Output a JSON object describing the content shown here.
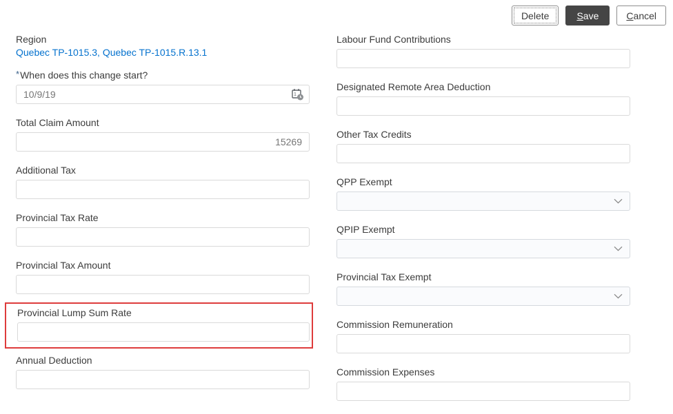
{
  "toolbar": {
    "delete_label": "Delete",
    "save_key": "S",
    "save_rest": "ave",
    "cancel_key": "C",
    "cancel_rest": "ancel"
  },
  "colors": {
    "link_blue": "#0572ce",
    "highlight_red": "#de3b3b",
    "save_button_bg": "#454545",
    "muted_value_gray": "#767676"
  },
  "region": {
    "label": "Region",
    "value": "Quebec TP-1015.3, Quebec TP-1015.R.13.1"
  },
  "left": {
    "start_date": {
      "required_marker": "*",
      "label": "When does this change start?",
      "value": "10/9/19",
      "icon": "calendar-clock-icon"
    },
    "total_claim": {
      "label": "Total Claim Amount",
      "value": "15269"
    },
    "additional_tax": {
      "label": "Additional Tax",
      "value": ""
    },
    "prov_tax_rate": {
      "label": "Provincial Tax Rate",
      "value": ""
    },
    "prov_tax_amount": {
      "label": "Provincial Tax Amount",
      "value": ""
    },
    "prov_lump_sum_rate": {
      "label": "Provincial Lump Sum Rate",
      "value": "",
      "highlighted": true
    },
    "annual_deduction": {
      "label": "Annual Deduction",
      "value": ""
    }
  },
  "right": {
    "labour_fund": {
      "label": "Labour Fund Contributions",
      "value": ""
    },
    "remote_area": {
      "label": "Designated Remote Area Deduction",
      "value": ""
    },
    "other_tax_credits": {
      "label": "Other Tax Credits",
      "value": ""
    },
    "qpp_exempt": {
      "label": "QPP Exempt",
      "value": ""
    },
    "qpip_exempt": {
      "label": "QPIP Exempt",
      "value": ""
    },
    "prov_tax_exempt": {
      "label": "Provincial Tax Exempt",
      "value": ""
    },
    "commission_remuneration": {
      "label": "Commission Remuneration",
      "value": ""
    },
    "commission_expenses": {
      "label": "Commission Expenses",
      "value": ""
    }
  }
}
